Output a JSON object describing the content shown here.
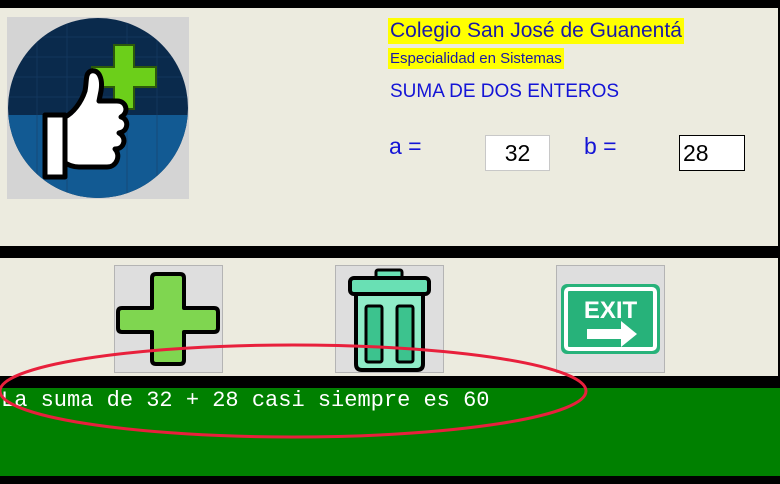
{
  "header": {
    "school": "Colegio San José de Guanentá",
    "specialty": "Especialidad en Sistemas",
    "program_title": "SUMA DE DOS ENTEROS",
    "logo_icon": "thumbs-up-plus-icon"
  },
  "inputs": {
    "a_label": "a =",
    "a_value": "32",
    "b_label": "b =",
    "b_value": "28"
  },
  "buttons": {
    "add_icon": "plus-icon",
    "clear_icon": "trash-icon",
    "exit_icon": "exit-sign-icon",
    "exit_text": "EXIT"
  },
  "output": {
    "text": "La suma de 32 + 28 casi siempre es 60"
  },
  "colors": {
    "panel": "#ecebdf",
    "title_highlight": "#ffff00",
    "label_blue": "#1414d6",
    "output_green": "#008000",
    "annotation_red": "#e8203c"
  }
}
